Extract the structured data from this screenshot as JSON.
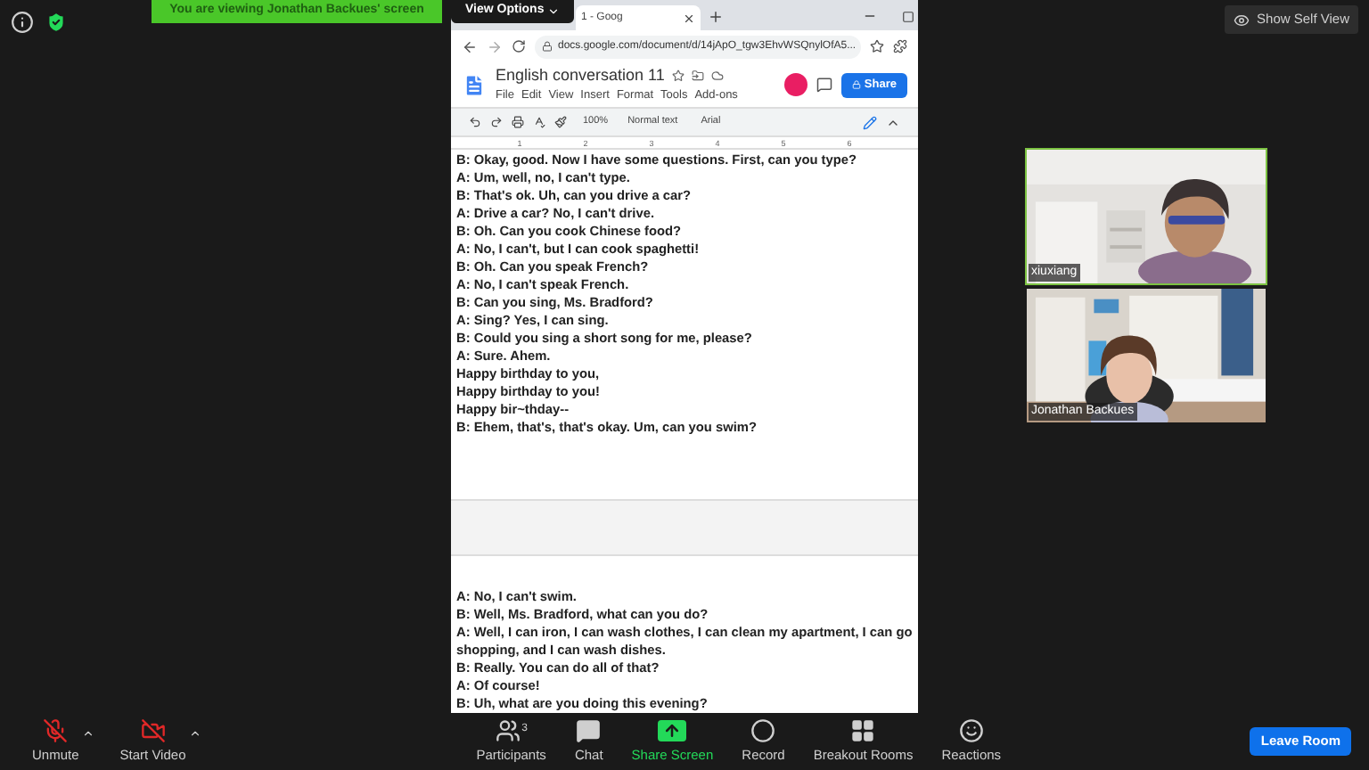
{
  "banner": {
    "text": "You are viewing Jonathan Backues' screen",
    "view_options": "View Options"
  },
  "browser": {
    "tab_title": "1 - Goog",
    "url": "docs.google.com/document/d/14jApO_tgw3EhvWSQnylOfA5...",
    "doc_title": "English conversation 11",
    "menu": [
      "File",
      "Edit",
      "View",
      "Insert",
      "Format",
      "Tools",
      "Add-ons"
    ],
    "share": "Share",
    "zoom": "100%",
    "style": "Normal text",
    "font": "Arial",
    "ruler": [
      "1",
      "2",
      "3",
      "4",
      "5",
      "6"
    ]
  },
  "pages": [
    {
      "lines": [
        "B: Okay, good. Now I have some questions. First, can you type?",
        "A: Um, well, no, I can't type.",
        "B: That's ok. Uh, can you drive a car?",
        "A: Drive a car? No, I can't drive.",
        "B: Oh. Can you cook Chinese food?",
        "A: No, I can't, but I can cook spaghetti!",
        "B: Oh. Can you speak French?",
        "A: No, I can't speak French.",
        "B: Can you sing, Ms. Bradford?",
        "A: Sing? Yes, I can sing.",
        "B: Could you sing a short song for me, please?",
        "A: Sure. Ahem.",
        "Happy birthday to you,",
        "Happy birthday to you!",
        "Happy bir~thday--",
        "B: Ehem, that's, that's okay. Um, can you swim?"
      ]
    },
    {
      "lines": [
        "A: No, I can't swim.",
        "B: Well, Ms. Bradford, what can you do?",
        "A: Well, I can iron, I can wash clothes, I can clean my apartment, I can go shopping, and I can wash dishes.",
        "B: Really. You can do all of that?",
        "A: Of course!",
        "B: Uh, what are you doing this evening?"
      ]
    }
  ],
  "show_self_view": "Show Self View",
  "participants": [
    {
      "name": "xiuxiang",
      "speaking": true
    },
    {
      "name": "Jonathan Backues",
      "speaking": false
    }
  ],
  "toolbar": [
    {
      "kind": "mic",
      "label": "Unmute",
      "off": true
    },
    {
      "kind": "video",
      "label": "Start Video",
      "off": true
    },
    {
      "kind": "participants",
      "label": "Participants",
      "count": "3"
    },
    {
      "kind": "chat",
      "label": "Chat"
    },
    {
      "kind": "share",
      "label": "Share Screen"
    },
    {
      "kind": "record",
      "label": "Record"
    },
    {
      "kind": "rooms",
      "label": "Breakout Rooms"
    },
    {
      "kind": "reactions",
      "label": "Reactions"
    }
  ],
  "leave": "Leave Room"
}
